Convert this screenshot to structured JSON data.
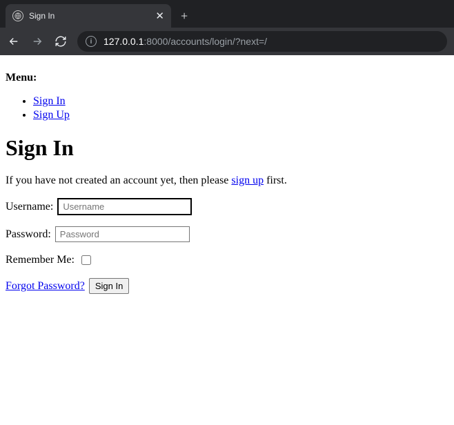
{
  "browser": {
    "tab_title": "Sign In",
    "url_host": "127.0.0.1",
    "url_port_path": ":8000/accounts/login/?next=/"
  },
  "page": {
    "menu_label": "Menu:",
    "menu_items": [
      {
        "label": "Sign In"
      },
      {
        "label": "Sign Up"
      }
    ],
    "heading": "Sign In",
    "helper_prefix": "If you have not created an account yet, then please ",
    "helper_link": "sign up",
    "helper_suffix": " first.",
    "form": {
      "username_label": "Username:",
      "username_placeholder": "Username",
      "username_value": "",
      "password_label": "Password:",
      "password_placeholder": "Password",
      "password_value": "",
      "remember_label": "Remember Me:",
      "remember_checked": false
    },
    "actions": {
      "forgot_label": "Forgot Password?",
      "submit_label": "Sign In"
    }
  }
}
